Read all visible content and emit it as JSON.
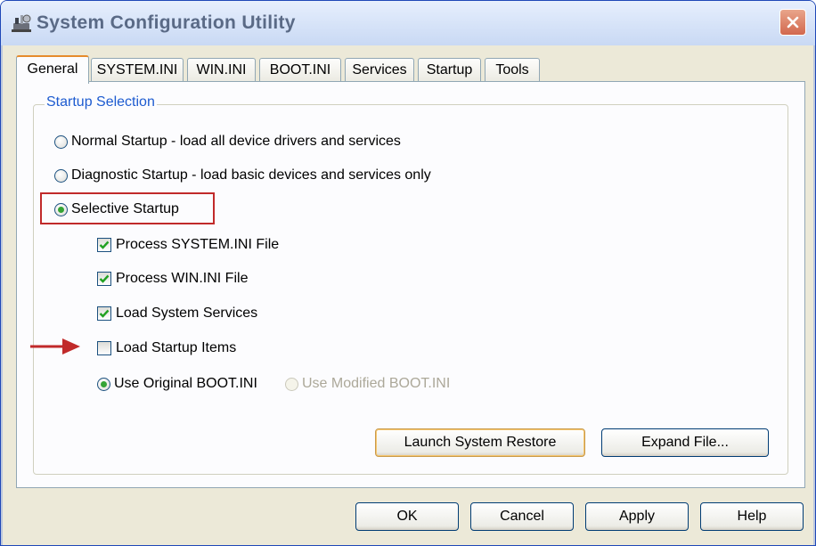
{
  "window": {
    "title": "System Configuration Utility",
    "icons": {
      "app": "msconfig-app-icon",
      "close": "close-icon"
    }
  },
  "tabs": [
    {
      "label": "General",
      "active": true
    },
    {
      "label": "SYSTEM.INI",
      "active": false
    },
    {
      "label": "WIN.INI",
      "active": false
    },
    {
      "label": "BOOT.INI",
      "active": false
    },
    {
      "label": "Services",
      "active": false
    },
    {
      "label": "Startup",
      "active": false
    },
    {
      "label": "Tools",
      "active": false
    }
  ],
  "startup_selection": {
    "title": "Startup Selection",
    "options": {
      "normal": {
        "label": "Normal Startup - load all device drivers and services",
        "selected": false
      },
      "diagnostic": {
        "label": "Diagnostic Startup - load basic devices and services only",
        "selected": false
      },
      "selective": {
        "label": "Selective Startup",
        "selected": true
      }
    },
    "checkboxes": {
      "system_ini": {
        "label": "Process SYSTEM.INI File",
        "checked": true
      },
      "win_ini": {
        "label": "Process WIN.INI File",
        "checked": true
      },
      "system_services": {
        "label": "Load System Services",
        "checked": true
      },
      "startup_items": {
        "label": "Load Startup Items",
        "checked": false
      }
    },
    "boot": {
      "original": {
        "label": "Use Original BOOT.INI",
        "selected": true,
        "enabled": true
      },
      "modified": {
        "label": "Use Modified BOOT.INI",
        "selected": false,
        "enabled": false
      }
    },
    "buttons": {
      "launch_restore": "Launch System Restore",
      "expand_file": "Expand File..."
    }
  },
  "footer_buttons": {
    "ok": "OK",
    "cancel": "Cancel",
    "apply": "Apply",
    "help": "Help"
  },
  "annotations": {
    "highlight_color": "#c12a2a",
    "arrow_color": "#c12a2a"
  },
  "colors": {
    "accent_tab": "#e68b2c",
    "group_title": "#1d5bd0",
    "radio_dot": "#35a435",
    "check_mark": "#21a121"
  }
}
